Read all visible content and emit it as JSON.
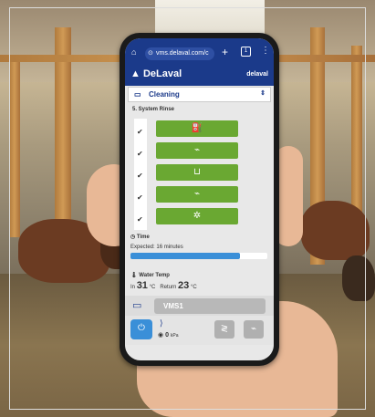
{
  "browser": {
    "url": "vms.delaval.com/c",
    "tab_count": "1"
  },
  "app": {
    "brand": "DeLaval",
    "user": "delaval"
  },
  "mode_select": {
    "value": "Cleaning"
  },
  "section": {
    "title": "5. System Rinse"
  },
  "steps": [
    {
      "icon": "basin-icon",
      "done": true
    },
    {
      "icon": "flush-icon",
      "done": true
    },
    {
      "icon": "tray-icon",
      "done": true
    },
    {
      "icon": "flush-icon",
      "done": true
    },
    {
      "icon": "fan-icon",
      "done": true
    }
  ],
  "time": {
    "label": "Time",
    "expected": "Expected: 16 minutes",
    "progress": 0.8
  },
  "water_temp": {
    "label": "Water Temp",
    "in_label": "In",
    "in_value": "31",
    "in_unit": "°C",
    "return_label": "Return",
    "return_value": "23",
    "return_unit": "°C"
  },
  "station": {
    "name": "VMS1"
  },
  "pressure": {
    "value": "0",
    "unit": "kPa"
  },
  "colors": {
    "brand": "#1b3a8a",
    "step_green": "#6aa832",
    "progress_blue": "#3a8fd8"
  }
}
